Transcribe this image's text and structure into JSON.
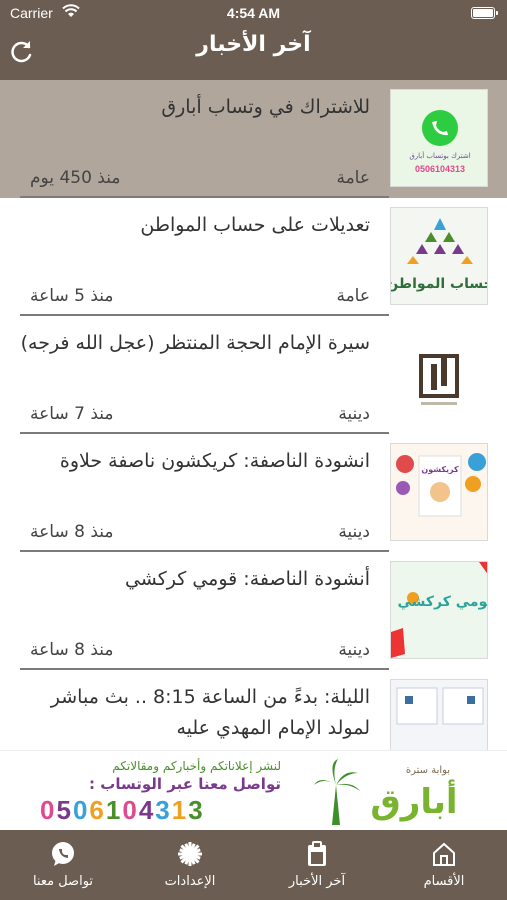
{
  "status_bar": {
    "carrier": "Carrier",
    "time": "4:54 AM"
  },
  "nav": {
    "title": "آخر الأخبار",
    "refresh_icon": "refresh-icon"
  },
  "news": [
    {
      "title": "للاشتراك في وتساب أبارق",
      "category": "عامة",
      "time_ago": "منذ 450 يوم",
      "highlighted": true,
      "thumb_text": "اشترك بوتساب أبارق"
    },
    {
      "title": "تعديلات على حساب المواطن",
      "category": "عامة",
      "time_ago": "منذ 5 ساعة",
      "highlighted": false,
      "thumb_text": "حساب المواطن"
    },
    {
      "title": "سيرة الإمام الحجة المنتظر (عجل الله فرجه)",
      "category": "دينية",
      "time_ago": "منذ 7 ساعة",
      "highlighted": false,
      "thumb_text": ""
    },
    {
      "title": "انشودة الناصفة: كريكشون ناصفة حلاوة",
      "category": "دينية",
      "time_ago": "منذ 8 ساعة",
      "highlighted": false,
      "thumb_text": "كريكشون"
    },
    {
      "title": "أنشودة الناصفة: قومي كركشي",
      "category": "دينية",
      "time_ago": "منذ 8 ساعة",
      "highlighted": false,
      "thumb_text": "قومي كركشي"
    },
    {
      "title": "الليلة: بدءً من الساعة 8:15 .. بث مباشر لمولد الإمام المهدي عليه",
      "category": "",
      "time_ago": "",
      "highlighted": false,
      "thumb_text": ""
    }
  ],
  "banner": {
    "line1": "لنشر إعلاناتكم وأخباركم ومقالاتكم",
    "line2": "تواصل معنا عبر الوتساب :",
    "phone": "0506104313",
    "phone_colors": [
      "#e04a8c",
      "#7a3a8c",
      "#3aa0d8",
      "#f0a020",
      "#4b8f2d",
      "#e04a8c",
      "#7a3a8c",
      "#3aa0d8",
      "#f0a020",
      "#4b8f2d"
    ],
    "logo_text": "أبارق",
    "logo_subtext": "بوابة سترة"
  },
  "tabs": [
    {
      "label": "الأقسام",
      "icon": "home-icon"
    },
    {
      "label": "آخر الأخبار",
      "icon": "clipboard-icon"
    },
    {
      "label": "الإعدادات",
      "icon": "gear-icon"
    },
    {
      "label": "تواصل معنا",
      "icon": "whatsapp-icon"
    }
  ],
  "colors": {
    "bar": "#6b5d51",
    "highlight_row": "#b0a69c",
    "separator": "#7b7b7b"
  }
}
